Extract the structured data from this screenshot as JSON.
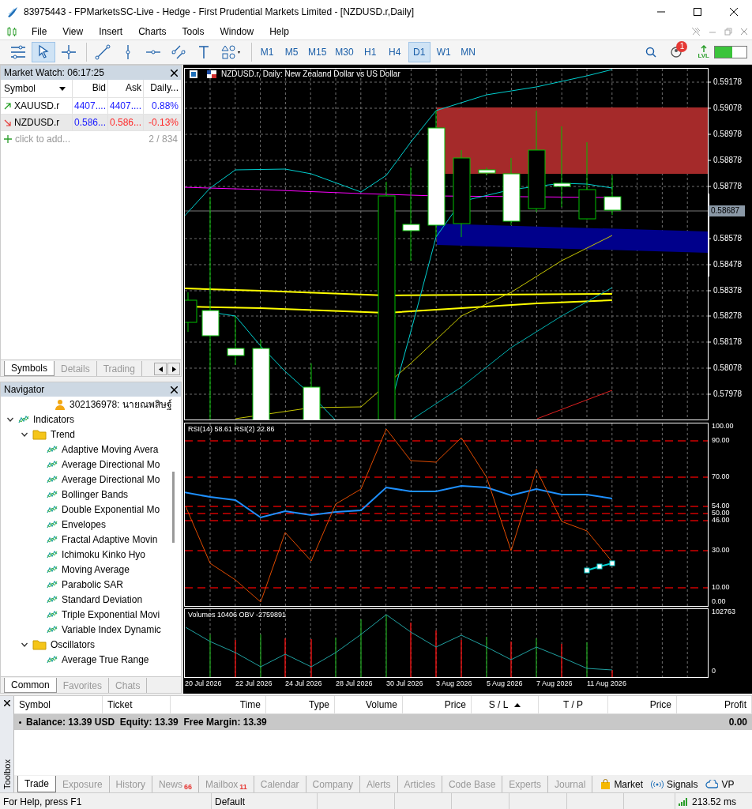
{
  "window": {
    "title": "83975443 - FPMarketsSC-Live - Hedge - First Prudential Markets Limited - [NZDUSD.r,Daily]"
  },
  "menu": [
    "File",
    "View",
    "Insert",
    "Charts",
    "Tools",
    "Window",
    "Help"
  ],
  "toolbar": {
    "tools": [
      {
        "kind": "lines",
        "selected": false
      },
      {
        "kind": "cursor",
        "selected": true
      },
      {
        "kind": "crosshair",
        "selected": false
      },
      {
        "kind": "trendline",
        "selected": false
      },
      {
        "kind": "vline",
        "selected": false
      },
      {
        "kind": "hline",
        "selected": false
      },
      {
        "kind": "channel",
        "selected": false
      },
      {
        "kind": "text",
        "selected": false
      },
      {
        "kind": "shapes",
        "selected": false
      }
    ],
    "timeframes": [
      {
        "label": "M1",
        "selected": false
      },
      {
        "label": "M5",
        "selected": false
      },
      {
        "label": "M15",
        "selected": false
      },
      {
        "label": "M30",
        "selected": false
      },
      {
        "label": "H1",
        "selected": false
      },
      {
        "label": "H4",
        "selected": false
      },
      {
        "label": "D1",
        "selected": true
      },
      {
        "label": "W1",
        "selected": false
      },
      {
        "label": "MN",
        "selected": false
      }
    ],
    "alerts_count": "1",
    "lvl_label": "LVL",
    "meter": {
      "level": 0.55
    }
  },
  "market_watch": {
    "title": "Market Watch: 06:17:25",
    "columns": [
      "Symbol",
      "Bid",
      "Ask",
      "Daily..."
    ],
    "rows": [
      {
        "symbol": "XAUUSD.r",
        "rising": true,
        "bid": "4407....",
        "ask": "4407....",
        "daily": "0.88%",
        "selected": false
      },
      {
        "symbol": "NZDUSD.r",
        "rising": false,
        "bid": "0.586...",
        "ask": "0.586...",
        "daily": "-0.13%",
        "selected": true
      }
    ],
    "add_label": "click to add...",
    "count": "2 / 834",
    "tabs": [
      {
        "label": "Symbols",
        "selected": true
      },
      {
        "label": "Details",
        "selected": false
      },
      {
        "label": "Trading",
        "selected": false
      }
    ]
  },
  "navigator": {
    "title": "Navigator",
    "tree": [
      {
        "label": "302136978: นายณพสิษฐ์",
        "kind": "account"
      },
      {
        "label": "Indicators",
        "kind": "indicators",
        "expanded": true,
        "children": [
          {
            "label": "Trend",
            "kind": "folder",
            "expanded": true,
            "children": [
              {
                "label": "Adaptive Moving Avera",
                "kind": "indicator"
              },
              {
                "label": "Average Directional Mo",
                "kind": "indicator"
              },
              {
                "label": "Average Directional Mo",
                "kind": "indicator"
              },
              {
                "label": "Bollinger Bands",
                "kind": "indicator"
              },
              {
                "label": "Double Exponential Mo",
                "kind": "indicator"
              },
              {
                "label": "Envelopes",
                "kind": "indicator"
              },
              {
                "label": "Fractal Adaptive Movin",
                "kind": "indicator"
              },
              {
                "label": "Ichimoku Kinko Hyo",
                "kind": "indicator"
              },
              {
                "label": "Moving Average",
                "kind": "indicator"
              },
              {
                "label": "Parabolic SAR",
                "kind": "indicator"
              },
              {
                "label": "Standard Deviation",
                "kind": "indicator"
              },
              {
                "label": "Triple Exponential Movi",
                "kind": "indicator"
              },
              {
                "label": "Variable Index Dynamic",
                "kind": "indicator"
              }
            ]
          },
          {
            "label": "Oscillators",
            "kind": "folder",
            "expanded": true,
            "children": [
              {
                "label": "Average True Range",
                "kind": "indicator"
              }
            ]
          }
        ]
      }
    ],
    "tabs": [
      {
        "label": "Common",
        "selected": true
      },
      {
        "label": "Favorites",
        "selected": false
      },
      {
        "label": "Chats",
        "selected": false
      }
    ]
  },
  "chart": {
    "header": "NZDUSD.r, Daily:  New Zealand Dollar vs US Dollar",
    "price_labels": [
      "0.59178",
      "0.59078",
      "0.58978",
      "0.58878",
      "0.58778",
      "0.58578",
      "0.58478",
      "0.58378",
      "0.58278",
      "0.58178",
      "0.58078",
      "0.57978"
    ],
    "current_price": "0.58687",
    "rsi_header": "RSI(14) 58.61 RSI(2) 22.86",
    "rsi_labels": [
      "100.00",
      "90.00",
      "70.00",
      "54.00",
      "50.00",
      "46.00",
      "30.00",
      "10.00",
      "0.00"
    ],
    "volume_header": "Volumes 10406 OBV -2759891",
    "volume_labels": [
      "102763",
      "0"
    ],
    "dates": [
      "20 Jul 2026",
      "22 Jul 2026",
      "24 Jul 2026",
      "28 Jul 2026",
      "30 Jul 2026",
      "3 Aug 2026",
      "5 Aug 2026",
      "7 Aug 2026",
      "11 Aug 2026"
    ]
  },
  "toolbox": {
    "label": "Toolbox",
    "columns": [
      {
        "label": "Symbol",
        "sorted": false
      },
      {
        "label": "Ticket",
        "sorted": false
      },
      {
        "label": "Time",
        "sorted": false
      },
      {
        "label": "Type",
        "sorted": false
      },
      {
        "label": "Volume",
        "sorted": false
      },
      {
        "label": "Price",
        "sorted": false
      },
      {
        "label": "S / L",
        "sorted": true
      },
      {
        "label": "T / P",
        "sorted": false
      },
      {
        "label": "Price",
        "sorted": false
      },
      {
        "label": "Profit",
        "sorted": false
      }
    ],
    "summary": "Balance: 13.39 USD  Equity: 13.39  Free Margin: 13.39",
    "profit": "0.00",
    "tabs": [
      {
        "label": "Trade",
        "selected": true
      },
      {
        "label": "Exposure",
        "selected": false
      },
      {
        "label": "History",
        "selected": false
      },
      {
        "label": "News",
        "selected": false,
        "badge": "66"
      },
      {
        "label": "Mailbox",
        "selected": false,
        "badge": "11"
      },
      {
        "label": "Calendar",
        "selected": false
      },
      {
        "label": "Company",
        "selected": false
      },
      {
        "label": "Alerts",
        "selected": false
      },
      {
        "label": "Articles",
        "selected": false
      },
      {
        "label": "Code Base",
        "selected": false
      },
      {
        "label": "Experts",
        "selected": false
      },
      {
        "label": "Journal",
        "selected": false
      }
    ],
    "links": [
      {
        "label": "Market",
        "kind": "market"
      },
      {
        "label": "Signals",
        "kind": "signals"
      },
      {
        "label": "VP",
        "kind": "vps"
      }
    ]
  },
  "status_bar": [
    {
      "text": "For Help, press F1",
      "kind": "help"
    },
    {
      "text": "Default",
      "kind": "profile"
    },
    {
      "text": "213.52 ms",
      "kind": "ping"
    }
  ]
}
